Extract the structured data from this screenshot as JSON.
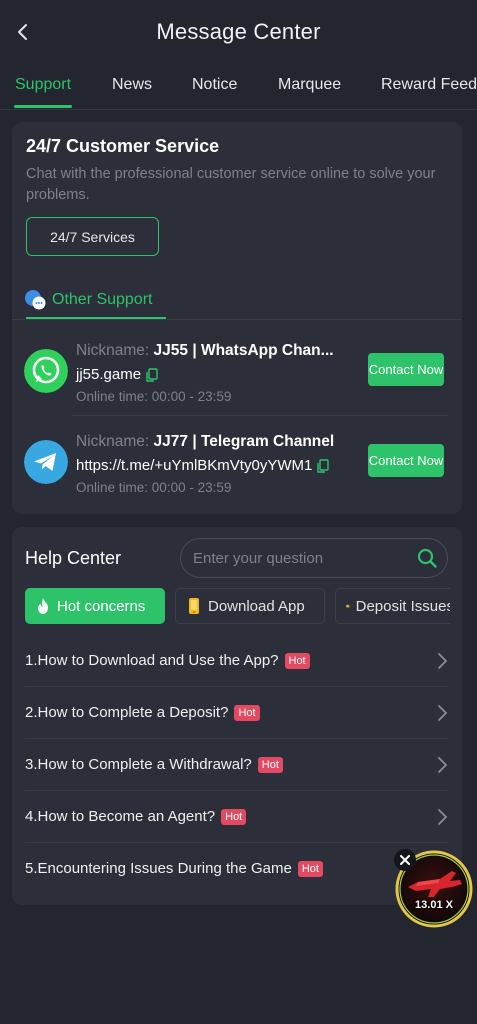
{
  "header": {
    "title": "Message Center"
  },
  "tabs": [
    {
      "label": "Support",
      "active": true
    },
    {
      "label": "News",
      "active": false
    },
    {
      "label": "Notice",
      "active": false
    },
    {
      "label": "Marquee",
      "active": false
    },
    {
      "label": "Reward Feedback",
      "active": false
    }
  ],
  "customer_service": {
    "title": "24/7 Customer Service",
    "description": "Chat with the professional customer service online to solve your problems.",
    "button_label": "24/7 Services"
  },
  "other_support": {
    "label": "Other Support",
    "nickname_label": "Nickname:",
    "online_label": "Online time:",
    "contacts": [
      {
        "nickname": "JJ55 | WhatsApp Chan...",
        "link": "jj55.game",
        "online_time": "00:00 - 23:59",
        "button_label": "Contact Now",
        "icon": "whatsapp-icon"
      },
      {
        "nickname": "JJ77 | Telegram Channel",
        "link": "https://t.me/+uYmlBKmVty0yYWM1",
        "online_time": "00:00 - 23:59",
        "button_label": "Contact Now",
        "icon": "telegram-icon"
      }
    ]
  },
  "help_center": {
    "title": "Help Center",
    "search_placeholder": "Enter your question",
    "chips": [
      {
        "label": "Hot concerns",
        "icon": "flame-icon",
        "active": true
      },
      {
        "label": "Download App",
        "icon": "phone-icon",
        "active": false
      },
      {
        "label": "Deposit Issues",
        "icon": "wallet-icon",
        "active": false
      }
    ],
    "hot_label": "Hot",
    "questions": [
      "1.How to Download and Use the App?",
      "2.How to Complete a Deposit?",
      "3.How to Complete a Withdrawal?",
      "4.How to Become an Agent?",
      "5.Encountering Issues During the Game"
    ]
  },
  "game_widget": {
    "multiplier": "13.01 X"
  },
  "colors": {
    "accent": "#2ec26a",
    "background": "#23252f",
    "card": "#2c2e39",
    "hot": "#e24a62"
  }
}
